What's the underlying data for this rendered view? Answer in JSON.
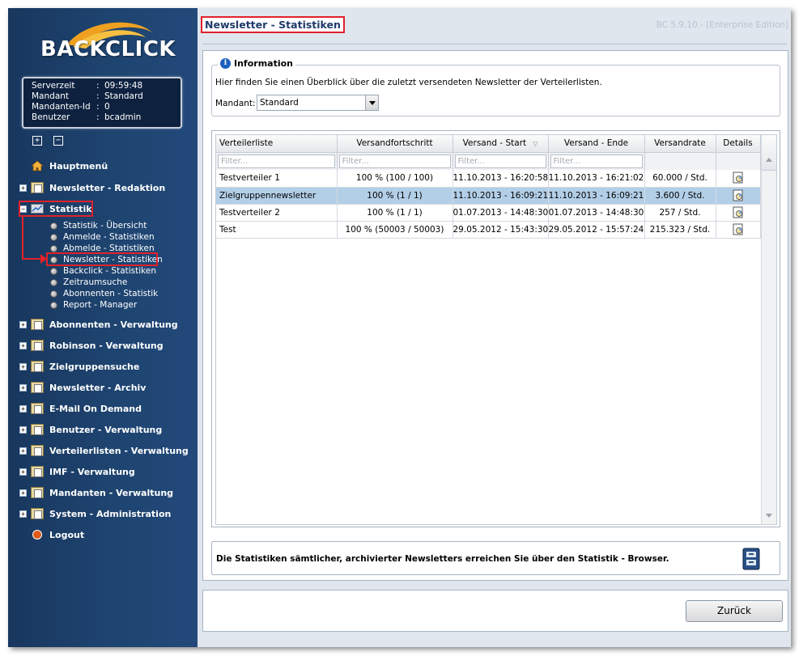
{
  "logo": {
    "text": "BACKCLICK"
  },
  "server_info": [
    {
      "key": "Serverzeit",
      "value": "09:59:48"
    },
    {
      "key": "Mandant",
      "value": "Standard"
    },
    {
      "key": "Mandanten-Id",
      "value": "0"
    },
    {
      "key": "Benutzer",
      "value": "bcadmin"
    }
  ],
  "sidebar": {
    "expand_all": "+",
    "collapse_all": "−",
    "hauptmenu": "Hauptmenü",
    "redaktion": "Newsletter - Redaktion",
    "statistik": "Statistik",
    "statistik_sub": [
      "Statistik - Übersicht",
      "Anmelde - Statistiken",
      "Abmelde - Statistiken",
      "Newsletter - Statistiken",
      "Backclick - Statistiken",
      "Zeitraumsuche",
      "Abonnenten - Statistik",
      "Report - Manager"
    ],
    "items": [
      "Abonnenten - Verwaltung",
      "Robinson - Verwaltung",
      "Zielgruppensuche",
      "Newsletter - Archiv",
      "E-Mail On Demand",
      "Benutzer - Verwaltung",
      "Verteilerlisten - Verwaltung",
      "IMF - Verwaltung",
      "Mandanten - Verwaltung",
      "System - Administration"
    ],
    "logout": "Logout"
  },
  "header": {
    "title": "Newsletter - Statistiken",
    "version": "BC 5.9.10 - [Enterprise Edition]"
  },
  "info": {
    "legend": "Information",
    "text": "Hier finden Sie einen Überblick über die zuletzt versendeten Newsletter der Verteilerlisten.",
    "mandant_label": "Mandant:",
    "mandant_value": "Standard"
  },
  "grid": {
    "columns": [
      "Verteilerliste",
      "Versandfortschritt",
      "Versand - Start",
      "Versand - Ende",
      "Versandrate",
      "Details"
    ],
    "filter_placeholder": "Filter...",
    "rows": [
      {
        "liste": "Testverteiler 1",
        "fortschritt": "100 % (100 / 100)",
        "start": "11.10.2013 - 16:20:58",
        "ende": "11.10.2013 - 16:21:02",
        "rate": "60.000 / Std.",
        "selected": false
      },
      {
        "liste": "Zielgruppennewsletter",
        "fortschritt": "100 % (1 / 1)",
        "start": "11.10.2013 - 16:09:21",
        "ende": "11.10.2013 - 16:09:21",
        "rate": "3.600 / Std.",
        "selected": true
      },
      {
        "liste": "Testverteiler 2",
        "fortschritt": "100 % (1 / 1)",
        "start": "01.07.2013 - 14:48:30",
        "ende": "01.07.2013 - 14:48:30",
        "rate": "257 / Std.",
        "selected": false
      },
      {
        "liste": "Test",
        "fortschritt": "100 % (50003 / 50003)",
        "start": "29.05.2012 - 15:43:30",
        "ende": "29.05.2012 - 15:57:24",
        "rate": "215.323 / Std.",
        "selected": false
      }
    ]
  },
  "browser_hint": "Die Statistiken sämtlicher, archivierter Newsletters erreichen Sie über den Statistik - Browser.",
  "footer": {
    "back_label": "Zurück"
  },
  "colors": {
    "sidebar": "#1e4470",
    "accent_red": "#e0222a",
    "title": "#1e3a6a",
    "selected_row": "#b3cfe8"
  }
}
